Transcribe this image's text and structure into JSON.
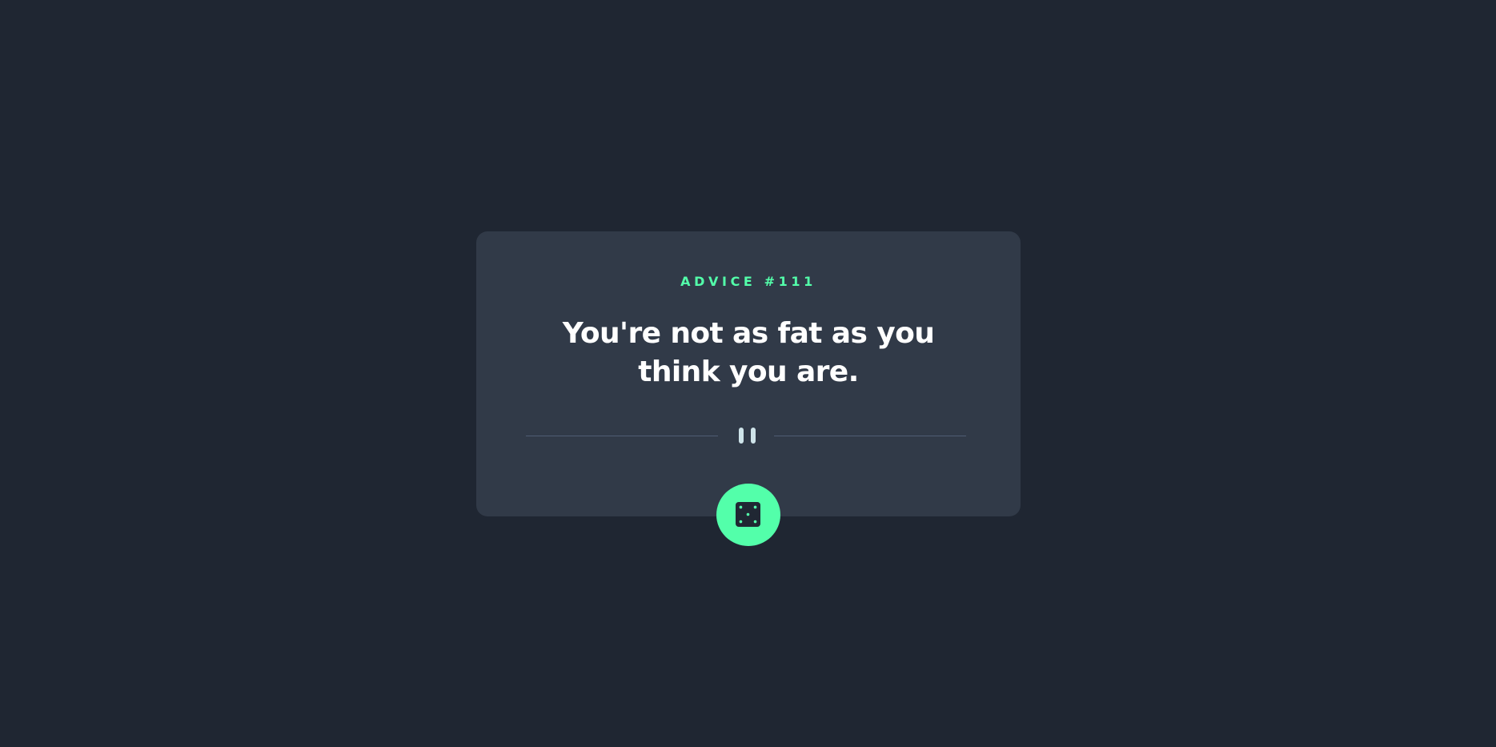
{
  "advice": {
    "label": "ADVICE #111",
    "quote": "You're not as fat as you think you are."
  },
  "icons": {
    "divider": "pause-icon",
    "button": "dice-icon"
  },
  "colors": {
    "background": "#1f2632",
    "card": "#313a48",
    "accent": "#53ffaa",
    "text": "#ffffff",
    "divider": "#4f5d74",
    "pause": "#cee3e9"
  }
}
